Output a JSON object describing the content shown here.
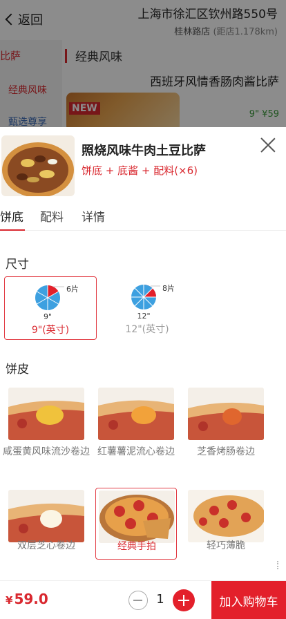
{
  "header": {
    "back_label": "返回",
    "address": "上海市徐汇区钦州路550号",
    "store": "桂林路店",
    "distance": "(距店1.178km)"
  },
  "background": {
    "sidebar": [
      "比萨",
      "经典风味",
      "甄选尊享"
    ],
    "category_title": "经典风味",
    "product_name": "西班牙风情香肠肉酱比萨",
    "new_badge": "NEW",
    "price_text": "9\" ¥59"
  },
  "product": {
    "name": "照烧风味牛肉土豆比萨",
    "desc": "饼底 + 底酱 + 配料(×6)"
  },
  "tabs": [
    "饼底",
    "配料",
    "详情"
  ],
  "size_section": {
    "title": "尺寸",
    "options": [
      {
        "slices": "6片",
        "inch": "9\"",
        "label": "9\"(英寸)",
        "selected": true
      },
      {
        "slices": "8片",
        "inch": "12\"",
        "label": "12\"(英寸)",
        "selected": false
      }
    ]
  },
  "crust_section": {
    "title": "饼皮",
    "options": [
      {
        "label": "咸蛋黄风味流沙卷边",
        "selected": false
      },
      {
        "label": "红薯薯泥流心卷边",
        "selected": false
      },
      {
        "label": "芝香烤肠卷边",
        "selected": false
      },
      {
        "label": "双层芝心卷边",
        "selected": false
      },
      {
        "label": "经典手拍",
        "selected": true
      },
      {
        "label": "轻巧薄脆",
        "selected": false
      }
    ]
  },
  "cart": {
    "currency": "¥",
    "price": "59.0",
    "quantity": "1",
    "add_label": "加入购物车"
  },
  "colors": {
    "accent": "#e3202b",
    "pie_blue": "#3da0e0",
    "pie_red": "#e3202b",
    "link_blue": "#3a68b5"
  }
}
